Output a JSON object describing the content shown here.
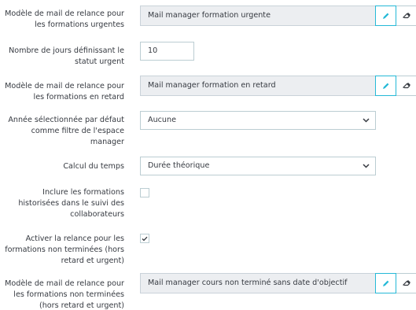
{
  "fields": {
    "urgent_template": {
      "label": "Modèle de mail de relance pour les formations urgentes",
      "value": "Mail manager formation urgente"
    },
    "urgent_days": {
      "label": "Nombre de jours définissant le statut urgent",
      "value": "10"
    },
    "late_template": {
      "label": "Modèle de mail de relance pour les formations en retard",
      "value": "Mail manager formation en retard"
    },
    "default_year": {
      "label": "Année sélectionnée par défaut comme filtre de l'espace manager",
      "selected": "Aucune"
    },
    "time_calc": {
      "label": "Calcul du temps",
      "selected": "Durée théorique"
    },
    "include_historized": {
      "label": "Inclure les formations historisées dans le suivi des collaborateurs",
      "checked": false
    },
    "enable_unfinished_reminder": {
      "label": "Activer la relance pour les formations non terminées (hors retard et urgent)",
      "checked": true
    },
    "unfinished_template": {
      "label": "Modèle de mail de relance pour les formations non terminées (hors retard et urgent)",
      "value": "Mail manager cours non terminé sans date d'objectif"
    }
  },
  "icons": {
    "edit": "pencil-icon",
    "clear": "eraser-icon"
  },
  "colors": {
    "accent": "#25b9d7",
    "readonly_bg": "#eceef1",
    "border": "#bbcdd2",
    "text": "#363a41"
  }
}
